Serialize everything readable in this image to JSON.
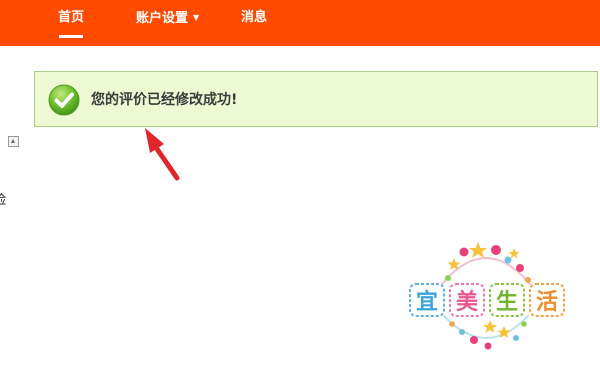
{
  "nav": {
    "items": [
      {
        "label": "首页",
        "active": true
      },
      {
        "label": "账户设置",
        "has_dropdown": true
      },
      {
        "label": "消息"
      }
    ],
    "background_color": "#ff4a00"
  },
  "message": {
    "text": "您的评价已经修改成功!",
    "type": "success",
    "icon": "checkmark-circle-icon",
    "background_color": "#edfad4",
    "border_color": "#a8d07e"
  },
  "side": {
    "partial_char": "险",
    "toggle_icon": "collapse-up-icon"
  },
  "annotation": {
    "icon": "red-arrow-icon",
    "color": "#e0262b"
  },
  "watermark": {
    "chars": [
      "宜",
      "美",
      "生",
      "活"
    ]
  }
}
